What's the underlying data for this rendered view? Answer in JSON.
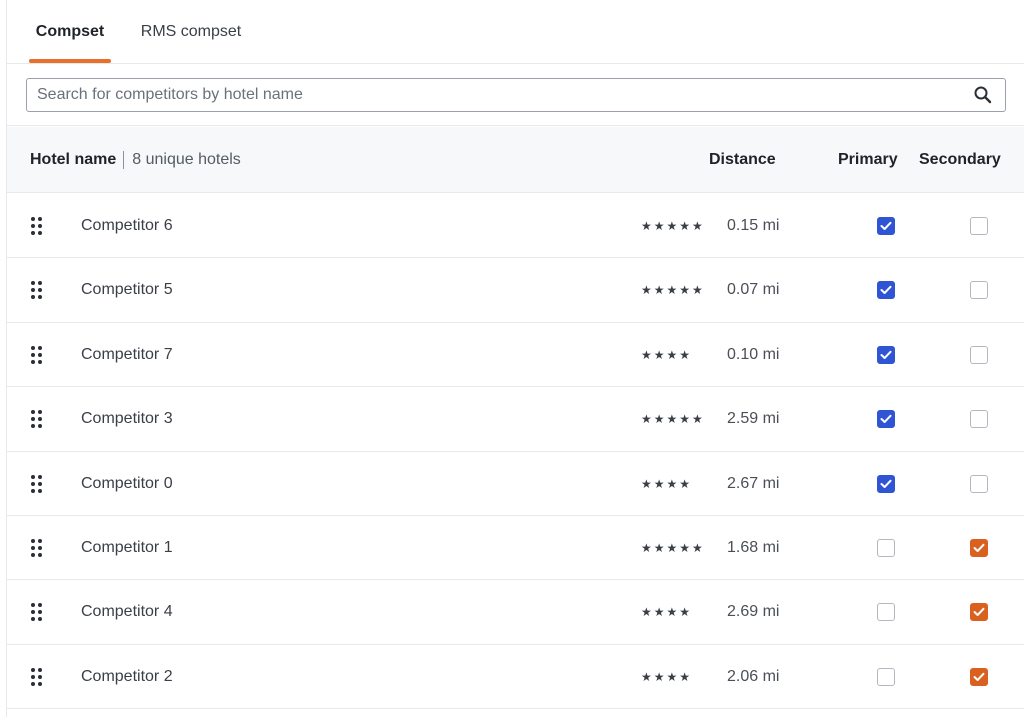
{
  "tabs": [
    {
      "label": "Compset",
      "active": true
    },
    {
      "label": "RMS compset",
      "active": false
    }
  ],
  "search": {
    "placeholder": "Search for competitors by hotel name",
    "value": ""
  },
  "table": {
    "headers": {
      "hotel_name": "Hotel name",
      "unique_count": "8 unique hotels",
      "distance": "Distance",
      "primary": "Primary",
      "secondary": "Secondary"
    },
    "rows": [
      {
        "name": "Competitor 6",
        "stars": "★★★★★",
        "distance": "0.15 mi",
        "primary": true,
        "secondary": false
      },
      {
        "name": "Competitor 5",
        "stars": "★★★★★",
        "distance": "0.07 mi",
        "primary": true,
        "secondary": false
      },
      {
        "name": "Competitor 7",
        "stars": "★★★★",
        "distance": "0.10 mi",
        "primary": true,
        "secondary": false
      },
      {
        "name": "Competitor 3",
        "stars": "★★★★★",
        "distance": "2.59 mi",
        "primary": true,
        "secondary": false
      },
      {
        "name": "Competitor 0",
        "stars": "★★★★",
        "distance": "2.67 mi",
        "primary": true,
        "secondary": false
      },
      {
        "name": "Competitor 1",
        "stars": "★★★★★",
        "distance": "1.68 mi",
        "primary": false,
        "secondary": true
      },
      {
        "name": "Competitor 4",
        "stars": "★★★★",
        "distance": "2.69 mi",
        "primary": false,
        "secondary": true
      },
      {
        "name": "Competitor 2",
        "stars": "★★★★",
        "distance": "2.06 mi",
        "primary": false,
        "secondary": true
      }
    ]
  },
  "colors": {
    "accent_tab": "#e8702a",
    "primary_check": "#2f55d4",
    "secondary_check": "#d9601e"
  },
  "icons": {
    "search": "search-icon",
    "drag": "drag-handle-icon",
    "check": "check-icon"
  }
}
